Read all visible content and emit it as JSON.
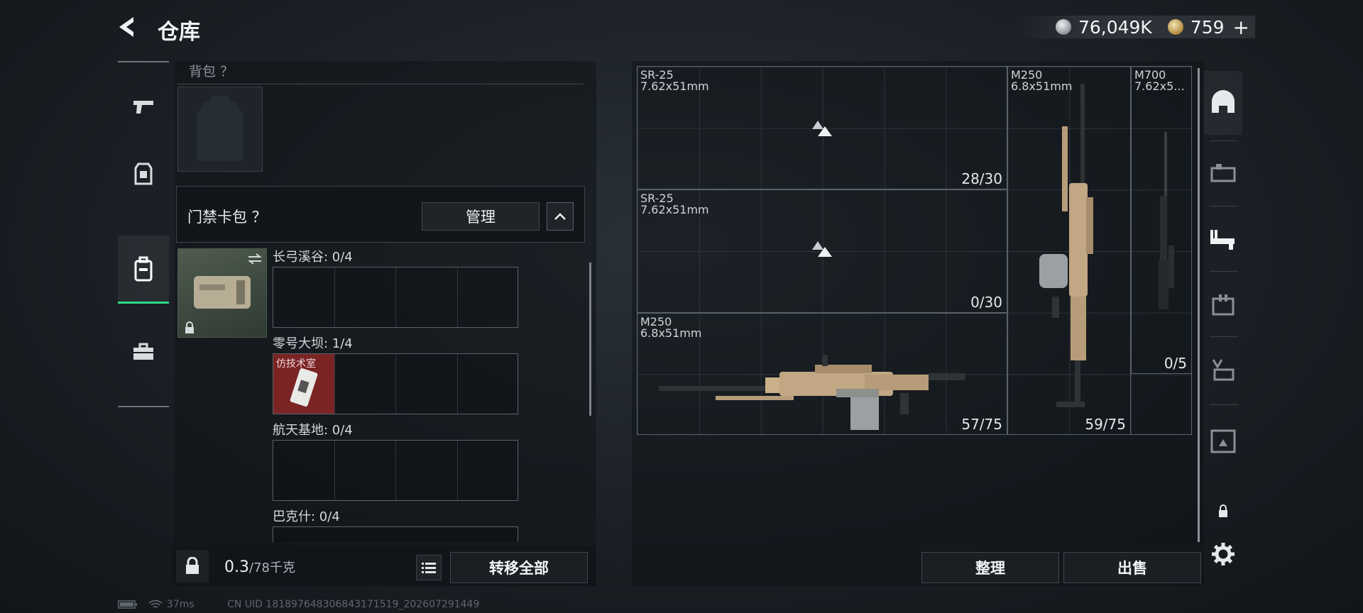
{
  "header": {
    "title": "仓库",
    "currency_silver": "76,049K",
    "currency_gold": "759",
    "plus": "+"
  },
  "left_rail": [
    "pistol-icon",
    "armor-icon",
    "backpack-icon",
    "toolbox-icon"
  ],
  "backpack": {
    "label": "背包 ？"
  },
  "card_bag": {
    "label": "门禁卡包 ？",
    "manage": "管理",
    "regions": [
      {
        "name": "长弓溪谷: 0/4",
        "slots": []
      },
      {
        "name": "零号大坝: 1/4",
        "slots": [
          {
            "label": "仿技术室"
          }
        ]
      },
      {
        "name": "航天基地: 0/4",
        "slots": []
      },
      {
        "name": "巴克什: 0/4",
        "slots": []
      }
    ]
  },
  "footer_left": {
    "weight": "0.3",
    "capacity": "/78千克",
    "transfer_all": "转移全部"
  },
  "status": {
    "ping": "37ms",
    "uid": "CN UID 181897648306843171519_202607291449"
  },
  "stash": {
    "items": [
      {
        "name": "SR-25",
        "ammo": "7.62x51mm",
        "count": "28/30"
      },
      {
        "name": "SR-25",
        "ammo": "7.62x51mm",
        "count": "0/30"
      },
      {
        "name": "M250",
        "ammo": "6.8x51mm",
        "count": "57/75"
      },
      {
        "name": "M250",
        "ammo": "6.8x51mm",
        "count": "59/75"
      },
      {
        "name": "M700",
        "ammo": "7.62x5...",
        "count": "0/5"
      }
    ],
    "arrange": "整理",
    "sell": "出售"
  },
  "right_rail": [
    "helmet-icon",
    "tactical-rig-icon",
    "weapon-rack-icon",
    "ammo-crate-icon",
    "attachment-icon",
    "container-icon",
    "lock-icon",
    "settings-icon"
  ],
  "colors": {
    "accent": "#2fd886",
    "keycard_bg": "#7a2424"
  }
}
